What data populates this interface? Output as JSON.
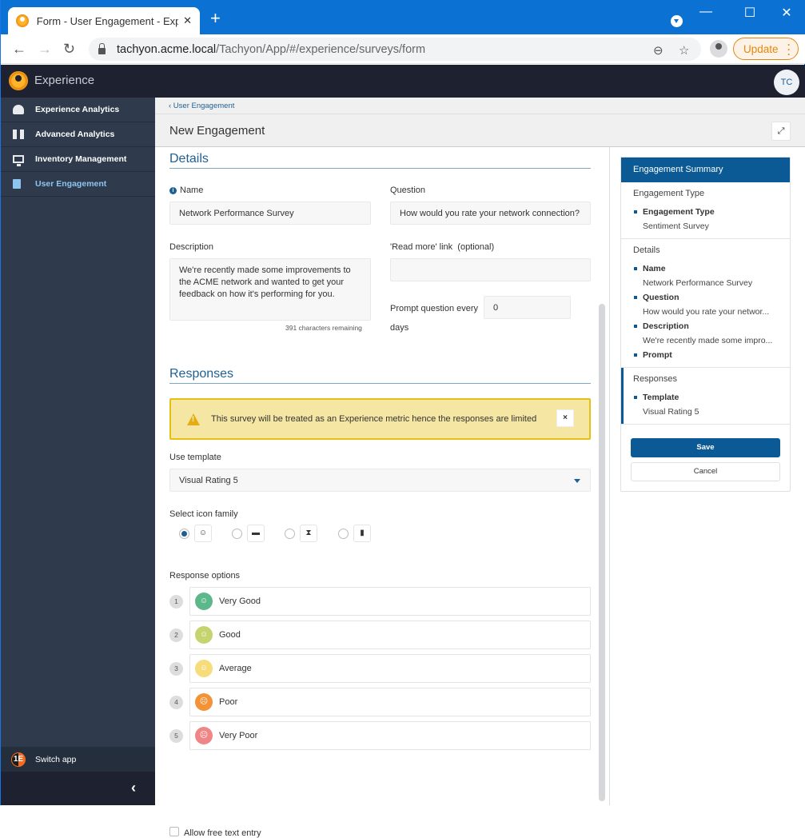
{
  "browser": {
    "tab_title": "Form - User Engagement - Experience",
    "tab_close": "✕",
    "new_tab": "+",
    "url_host": "tachyon.acme.local",
    "url_path": "/Tachyon/App/#/experience/surveys/form",
    "update_label": "Update",
    "window_controls": {
      "minimize": "—",
      "maximize": "☐",
      "close": "✕"
    }
  },
  "app": {
    "name": "Experience",
    "user_initials": "TC"
  },
  "sidebar": {
    "items": [
      {
        "label": "Experience Analytics",
        "icon": "gauge-icon",
        "active": false
      },
      {
        "label": "Advanced Analytics",
        "icon": "binoculars-icon",
        "active": false
      },
      {
        "label": "Inventory Management",
        "icon": "monitor-icon",
        "active": false
      },
      {
        "label": "User Engagement",
        "icon": "clipboard-icon",
        "active": true
      }
    ],
    "switch_app": "Switch app",
    "switch_logo": "1E",
    "collapse": "‹"
  },
  "page": {
    "breadcrumb": "‹ User Engagement",
    "title": "New Engagement",
    "expand_icon": "⤢"
  },
  "details": {
    "heading": "Details",
    "name_label": "Name",
    "name_value": "Network Performance Survey",
    "question_label": "Question",
    "question_value": "How would you rate your network connection?",
    "description_label": "Description",
    "description_value": "We're recently made some improvements to the ACME network and wanted to get your feedback on how it's performing for you.",
    "chars_remaining": "391 characters remaining",
    "readmore_label": "'Read more' link  (optional)",
    "readmore_value": "",
    "prompt_label": "Prompt question every",
    "prompt_value": "0",
    "prompt_unit": "days"
  },
  "responses": {
    "heading": "Responses",
    "warning": "This survey will be treated as an Experience metric hence the responses are limited",
    "warning_close": "×",
    "template_label": "Use template",
    "template_value": "Visual Rating 5",
    "icon_family_label": "Select icon family",
    "icon_families": [
      {
        "icon": "smiley-icon",
        "glyph": "☺",
        "selected": true
      },
      {
        "icon": "battery-icon",
        "glyph": "▬",
        "selected": false
      },
      {
        "icon": "hourglass-icon",
        "glyph": "⧗",
        "selected": false
      },
      {
        "icon": "thermometer-icon",
        "glyph": "🌡",
        "selected": false
      }
    ],
    "options_label": "Response options",
    "options": [
      {
        "num": "1",
        "label": "Very Good",
        "color": "#5cb88a",
        "glyph": "☺"
      },
      {
        "num": "2",
        "label": "Good",
        "color": "#c5d46f",
        "glyph": "☺"
      },
      {
        "num": "3",
        "label": "Average",
        "color": "#f7dc7c",
        "glyph": "☺"
      },
      {
        "num": "4",
        "label": "Poor",
        "color": "#f39237",
        "glyph": "☹"
      },
      {
        "num": "5",
        "label": "Very Poor",
        "color": "#f08585",
        "glyph": "☹"
      }
    ],
    "free_text_label": "Allow free text entry",
    "free_text_checked": false
  },
  "summary": {
    "heading": "Engagement Summary",
    "sections": [
      {
        "title": "Engagement Type",
        "items": [
          {
            "key": "Engagement Type",
            "value": "Sentiment Survey"
          }
        ]
      },
      {
        "title": "Details",
        "items": [
          {
            "key": "Name",
            "value": "Network Performance Survey"
          },
          {
            "key": "Question",
            "value": "How would you rate your networ..."
          },
          {
            "key": "Description",
            "value": "We're recently made some impro..."
          },
          {
            "key": "Prompt",
            "value": ""
          }
        ]
      },
      {
        "title": "Responses",
        "items": [
          {
            "key": "Template",
            "value": "Visual Rating 5"
          }
        ]
      }
    ],
    "save_label": "Save",
    "cancel_label": "Cancel"
  },
  "colors": {
    "accent": "#0b5a96",
    "warning_bg": "#f5e7a3",
    "warning_border": "#e5c113",
    "sidebar_bg": "#2f3a4c",
    "header_bg": "#1e2230",
    "chrome_blue": "#0b72d4"
  }
}
